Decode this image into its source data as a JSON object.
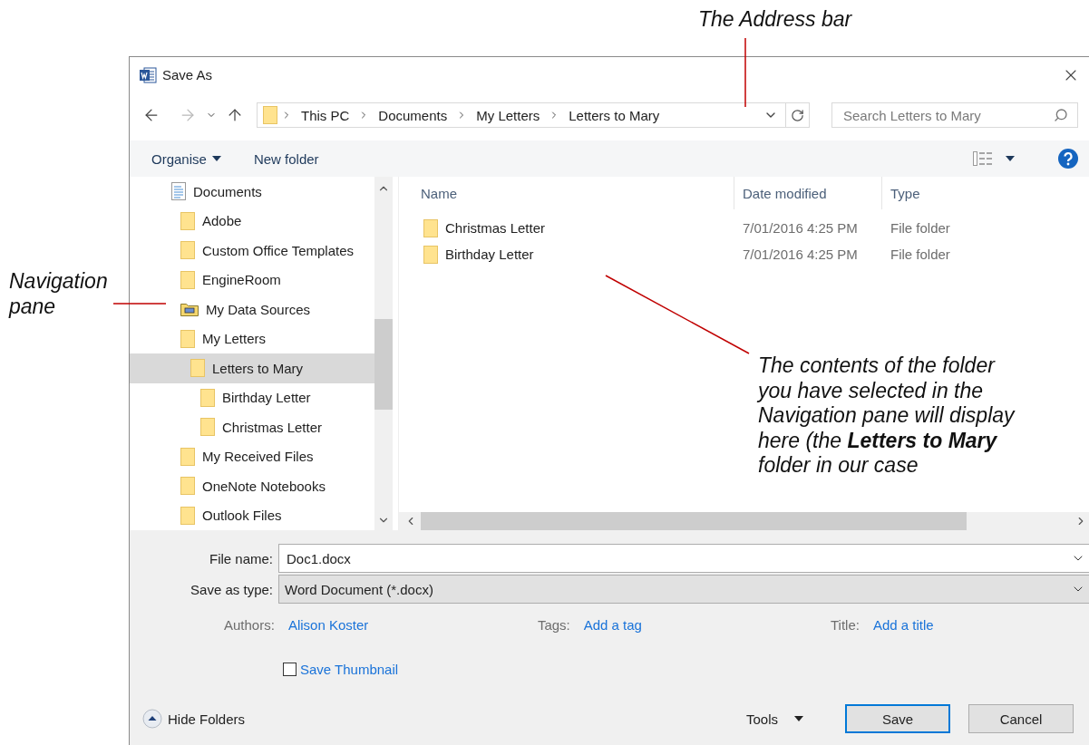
{
  "callouts": {
    "address_bar": "The Address bar",
    "navigation_pane": "Navigation pane",
    "contents": "The contents of the folder you have selected in the Navigation pane will display here (the **Letters to Mary** folder in our case"
  },
  "window": {
    "title": "Save As"
  },
  "address_bar": {
    "crumbs": [
      "This PC",
      "Documents",
      "My Letters",
      "Letters to Mary"
    ]
  },
  "search": {
    "placeholder": "Search Letters to Mary"
  },
  "toolbar": {
    "organise": "Organise",
    "new_folder": "New folder"
  },
  "nav_pane": {
    "items": [
      {
        "label": "Documents",
        "kind": "document",
        "selected": false,
        "children": [
          {
            "label": "Adobe",
            "kind": "folder",
            "selected": false
          },
          {
            "label": "Custom Office Templates",
            "kind": "folder",
            "selected": false
          },
          {
            "label": "EngineRoom",
            "kind": "folder",
            "selected": false
          },
          {
            "label": "My Data Sources",
            "kind": "data-folder",
            "selected": false
          },
          {
            "label": "My Letters",
            "kind": "folder",
            "selected": false,
            "children": [
              {
                "label": "Letters to Mary",
                "kind": "folder",
                "selected": true,
                "children": [
                  {
                    "label": "Birthday Letter",
                    "kind": "folder",
                    "selected": false
                  },
                  {
                    "label": "Christmas Letter",
                    "kind": "folder",
                    "selected": false
                  }
                ]
              }
            ]
          },
          {
            "label": "My Received Files",
            "kind": "folder",
            "selected": false
          },
          {
            "label": "OneNote Notebooks",
            "kind": "folder",
            "selected": false
          },
          {
            "label": "Outlook Files",
            "kind": "folder",
            "selected": false
          }
        ]
      }
    ]
  },
  "file_list": {
    "columns": [
      "Name",
      "Date modified",
      "Type"
    ],
    "rows": [
      {
        "name": "Christmas Letter",
        "date_modified": "7/01/2016 4:25 PM",
        "type": "File folder"
      },
      {
        "name": "Birthday Letter",
        "date_modified": "7/01/2016 4:25 PM",
        "type": "File folder"
      }
    ]
  },
  "file_name": {
    "label": "File name:",
    "value": "Doc1.docx"
  },
  "save_as_type": {
    "label": "Save as type:",
    "value": "Word Document (*.docx)"
  },
  "metadata": [
    {
      "label": "Authors:",
      "value": "Alison Koster"
    },
    {
      "label": "Tags:",
      "value": "Add a tag"
    },
    {
      "label": "Title:",
      "value": "Add a title"
    }
  ],
  "thumbnail": {
    "label": "Save Thumbnail",
    "checked": false
  },
  "hide_folders": "Hide Folders",
  "tools": "Tools",
  "buttons": [
    {
      "label": "Save",
      "default": true
    },
    {
      "label": "Cancel",
      "default": false
    }
  ]
}
